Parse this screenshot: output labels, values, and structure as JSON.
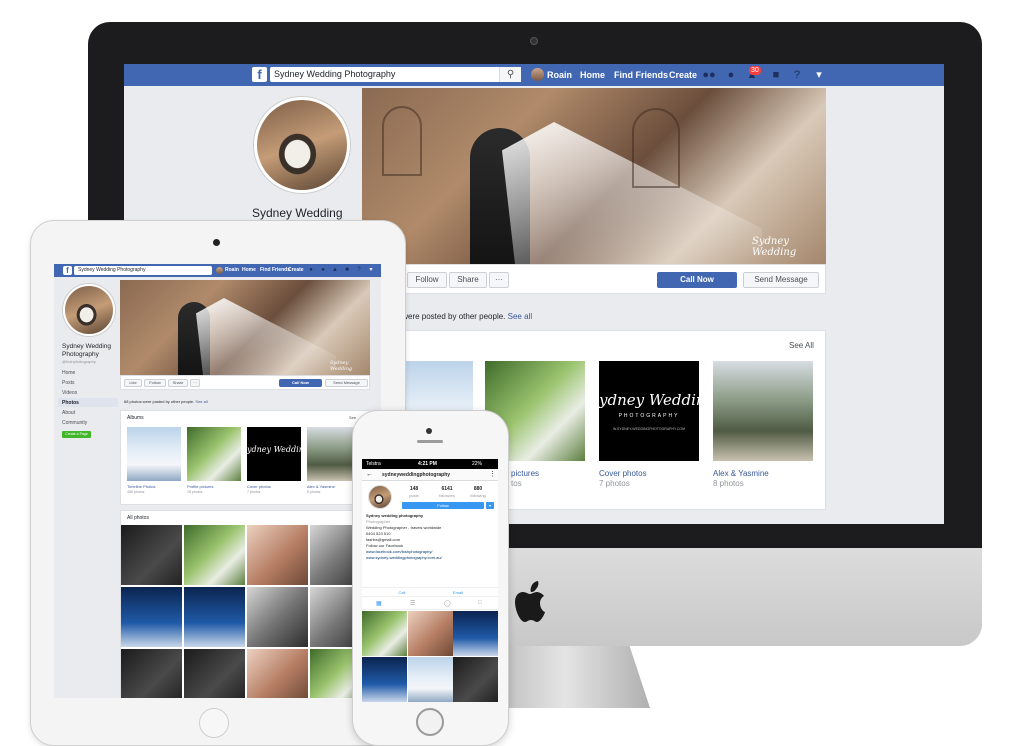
{
  "desktop": {
    "search_value": "Sydney Wedding Photography",
    "user_name": "Roain",
    "nav": {
      "home": "Home",
      "find_friends": "Find Friends",
      "create": "Create"
    },
    "notification_count": "30",
    "page_title": "Sydney Wedding",
    "actions": {
      "follow": "Follow",
      "share": "Share",
      "more": "···",
      "call_now": "Call Now",
      "send_message": "Send Message"
    },
    "posted_by_others_tail": "s were posted by other people.",
    "see_all_link": "See all",
    "albums_see_all": "See All",
    "albums": [
      {
        "name": "pictures",
        "count": "tos"
      },
      {
        "name": "Cover photos",
        "count": "7 photos"
      },
      {
        "name": "Alex & Yasmine",
        "count": "8 photos"
      }
    ],
    "logo_script": "ydney Weddin",
    "logo_sub": "PHOTOGRAPHY",
    "logo_url": "W.SYDNEY-WEDDINGPHOTOGRAPHY.COM"
  },
  "tablet": {
    "search_value": "Sydney Wedding Photography",
    "user_name": "Roain",
    "nav": {
      "home": "Home",
      "find_friends": "Find Friends",
      "create": "Create"
    },
    "page_title_line1": "Sydney Wedding",
    "page_title_line2": "Photography",
    "page_handle": "@foshphotography",
    "sidebar": [
      "Home",
      "Posts",
      "Videos",
      "Photos",
      "About",
      "Community"
    ],
    "create_page": "Create a Page",
    "actions": {
      "like": "Like",
      "follow": "Follow",
      "share": "Share",
      "more": "···",
      "call_now": "Call Now",
      "send_message": "Send Message"
    },
    "posted_by_others": "68 photos were posted by other people.",
    "see_all_link": "See all",
    "albums_title": "Albums",
    "albums_see_all": "See",
    "albums": [
      {
        "name": "Timeline Photos",
        "count": "456 photos"
      },
      {
        "name": "Profile pictures",
        "count": "15 photos"
      },
      {
        "name": "Cover photos",
        "count": "7 photos"
      },
      {
        "name": "Alex & Yasmine",
        "count": "8 photos"
      }
    ],
    "all_photos_title": "All photos"
  },
  "phone": {
    "carrier": "Telstra",
    "time": "4:21 PM",
    "battery": "22%",
    "username": "sydneyweddingphotography",
    "stats": [
      {
        "value": "148",
        "label": "posts"
      },
      {
        "value": "6141",
        "label": "followers"
      },
      {
        "value": "880",
        "label": "following"
      }
    ],
    "follow": "Follow",
    "bio_name": "Sydney wedding photography",
    "bio_category": "Photographer",
    "bio_lines": [
      "Wedding Photographer - travels worldwide",
      "0404 523 510",
      "fashbs@gmail.com",
      "Follow our Facebook",
      "www.facebook.com/foshphotography/",
      "www.sydney-weddingphotography.com.au/"
    ],
    "call": "Call",
    "email": "Email"
  }
}
